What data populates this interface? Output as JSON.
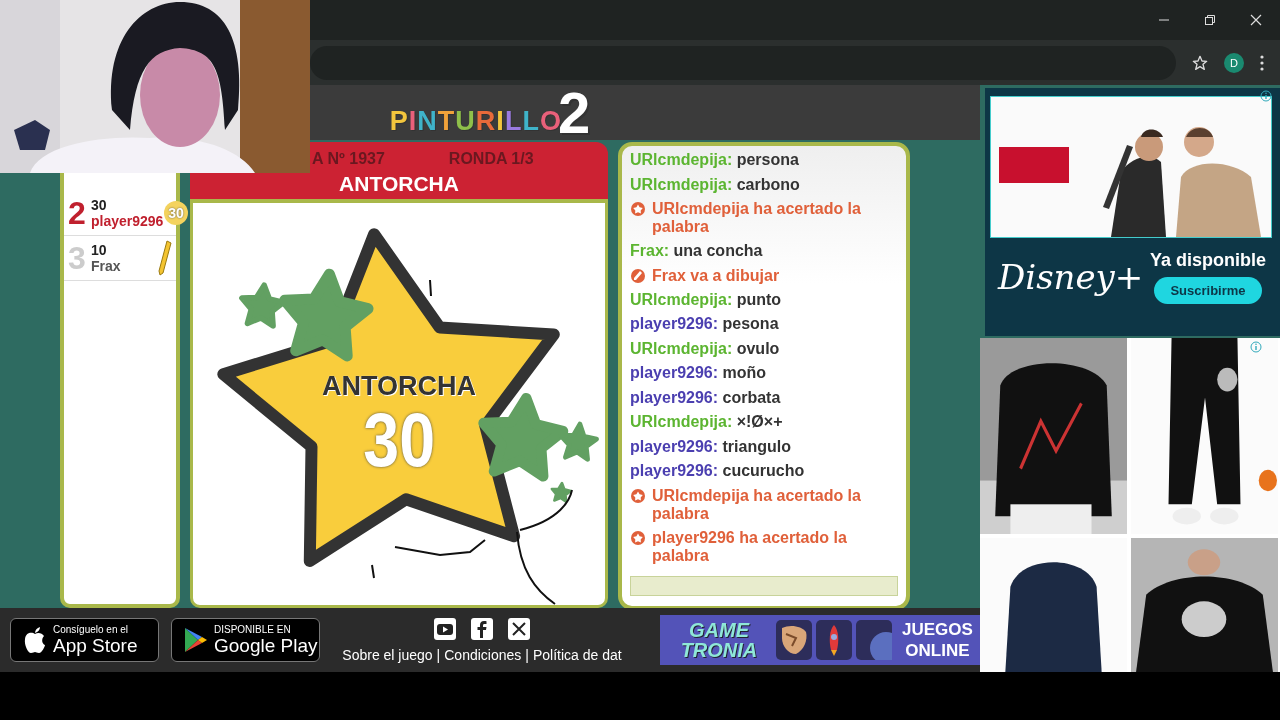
{
  "browser": {
    "profile_initial": "D"
  },
  "logo": {
    "name": "PINTURILLO",
    "number": "2"
  },
  "round": {
    "game": "A Nº 1937",
    "round": "RONDA 1/3",
    "word": "ANTORCHA"
  },
  "players": [
    {
      "rank": "2",
      "score": "30",
      "name": "player9296",
      "badge": "30",
      "kind": "scored",
      "highlighted": true
    },
    {
      "rank": "3",
      "score": "10",
      "name": "Frax",
      "kind": "drawing",
      "highlighted": false
    }
  ],
  "canvas": {
    "word": "ANTORCHA",
    "points": "30"
  },
  "chat": [
    {
      "kind": "message",
      "author": "URlcmdepija:",
      "text": "persona",
      "color": "#5cb531"
    },
    {
      "kind": "message",
      "author": "URlcmdepija:",
      "text": "carbono",
      "color": "#5cb531"
    },
    {
      "kind": "guessed",
      "text": "URlcmdepija ha acertado la palabra"
    },
    {
      "kind": "message",
      "author": "Frax:",
      "text": "una concha",
      "color": "#5cb531"
    },
    {
      "kind": "drawing",
      "text": "Frax va a dibujar"
    },
    {
      "kind": "message",
      "author": "URlcmdepija:",
      "text": "punto",
      "color": "#5cb531"
    },
    {
      "kind": "message",
      "author": "player9296:",
      "text": "pesona",
      "color": "#4b3fb0"
    },
    {
      "kind": "message",
      "author": "URlcmdepija:",
      "text": "ovulo",
      "color": "#5cb531"
    },
    {
      "kind": "message",
      "author": "player9296:",
      "text": "moño",
      "color": "#4b3fb0"
    },
    {
      "kind": "message",
      "author": "player9296:",
      "text": "corbata",
      "color": "#4b3fb0"
    },
    {
      "kind": "message",
      "author": "URlcmdepija:",
      "text": "×!Ø×+",
      "color": "#5cb531"
    },
    {
      "kind": "message",
      "author": "player9296:",
      "text": "triangulo",
      "color": "#4b3fb0"
    },
    {
      "kind": "message",
      "author": "player9296:",
      "text": "cucurucho",
      "color": "#4b3fb0"
    },
    {
      "kind": "guessed",
      "text": "URlcmdepija ha acertado la palabra"
    },
    {
      "kind": "guessed",
      "text": "player9296 ha acertado la palabra"
    }
  ],
  "footer": {
    "app_store": {
      "caption": "Consíguelo en el",
      "name": "App Store"
    },
    "google_play": {
      "caption": "DISPONIBLE EN",
      "name": "Google Play"
    },
    "links": [
      "Sobre el juego",
      "Condiciones",
      "Política de dat"
    ],
    "separator": "|",
    "gametronia": {
      "logo_lines": [
        "GAME",
        "TRONIA"
      ],
      "tagline_lines": [
        "JUEGOS",
        "ONLINE"
      ]
    }
  },
  "ads": {
    "promo": {
      "brand": "Disney+",
      "headline": "Ya disponible",
      "button": "Suscribirme"
    }
  }
}
